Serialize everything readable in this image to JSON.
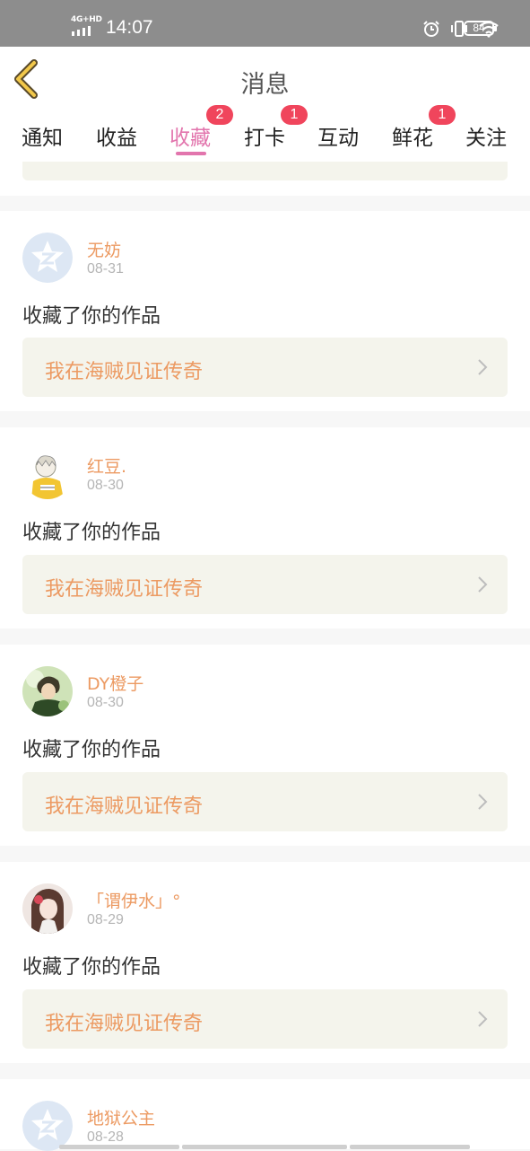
{
  "status_bar": {
    "network": "4G+HD",
    "time": "14:07",
    "battery": "84",
    "icons": [
      "alarm-icon",
      "vibrate-icon",
      "wifi-icon",
      "battery-icon"
    ]
  },
  "nav": {
    "title": "消息",
    "back_icon": "chevron-left-icon"
  },
  "tabs": [
    {
      "label": "通知",
      "badge": ""
    },
    {
      "label": "收益",
      "badge": ""
    },
    {
      "label": "收藏",
      "badge": "2",
      "active": true
    },
    {
      "label": "打卡",
      "badge": "1"
    },
    {
      "label": "互动",
      "badge": ""
    },
    {
      "label": "鲜花",
      "badge": "1"
    },
    {
      "label": "关注",
      "badge": ""
    }
  ],
  "colors": {
    "accent": "#e275ad",
    "badge": "#f0455c",
    "name": "#ec9a62",
    "work_bg": "#f4f4ec",
    "status_bar": "#8d8d8d"
  },
  "items": [
    {
      "name": "无妨",
      "date": "08-31",
      "action": "收藏了你的作品",
      "work": "我在海贼见证传奇",
      "avatar": "default-avatar-icon"
    },
    {
      "name": "红豆.",
      "date": "08-30",
      "action": "收藏了你的作品",
      "work": "我在海贼见证传奇",
      "avatar": "anime-boy-avatar"
    },
    {
      "name": "DY橙子",
      "date": "08-30",
      "action": "收藏了你的作品",
      "work": "我在海贼见证传奇",
      "avatar": "green-anime-avatar"
    },
    {
      "name": "「谓伊水」°",
      "date": "08-29",
      "action": "收藏了你的作品",
      "work": "我在海贼见证传奇",
      "avatar": "anime-girl-avatar"
    },
    {
      "name": "地狱公主",
      "date": "08-28",
      "action": "",
      "work": "",
      "avatar": "default-avatar-icon"
    }
  ]
}
